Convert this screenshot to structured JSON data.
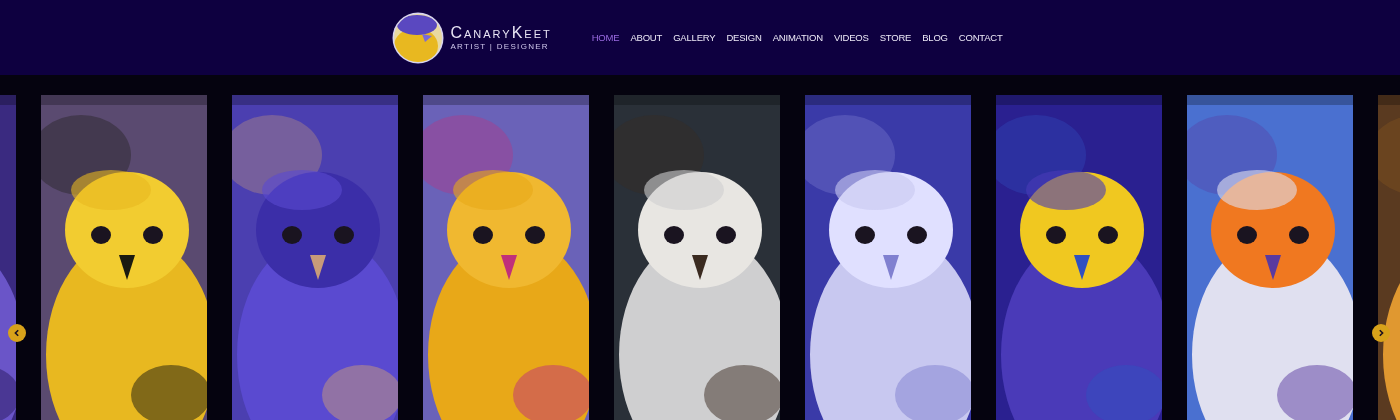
{
  "brand": {
    "name": "CanaryKeet",
    "tagline": "ARTIST | DESIGNER"
  },
  "nav": [
    {
      "label": "HOME",
      "selected": true
    },
    {
      "label": "ABOUT",
      "selected": false
    },
    {
      "label": "GALLERY",
      "selected": false
    },
    {
      "label": "DESIGN",
      "selected": false
    },
    {
      "label": "ANIMATION",
      "selected": false
    },
    {
      "label": "VIDEOS",
      "selected": false
    },
    {
      "label": "STORE",
      "selected": false
    },
    {
      "label": "BLOG",
      "selected": false
    },
    {
      "label": "CONTACT",
      "selected": false
    }
  ]
}
